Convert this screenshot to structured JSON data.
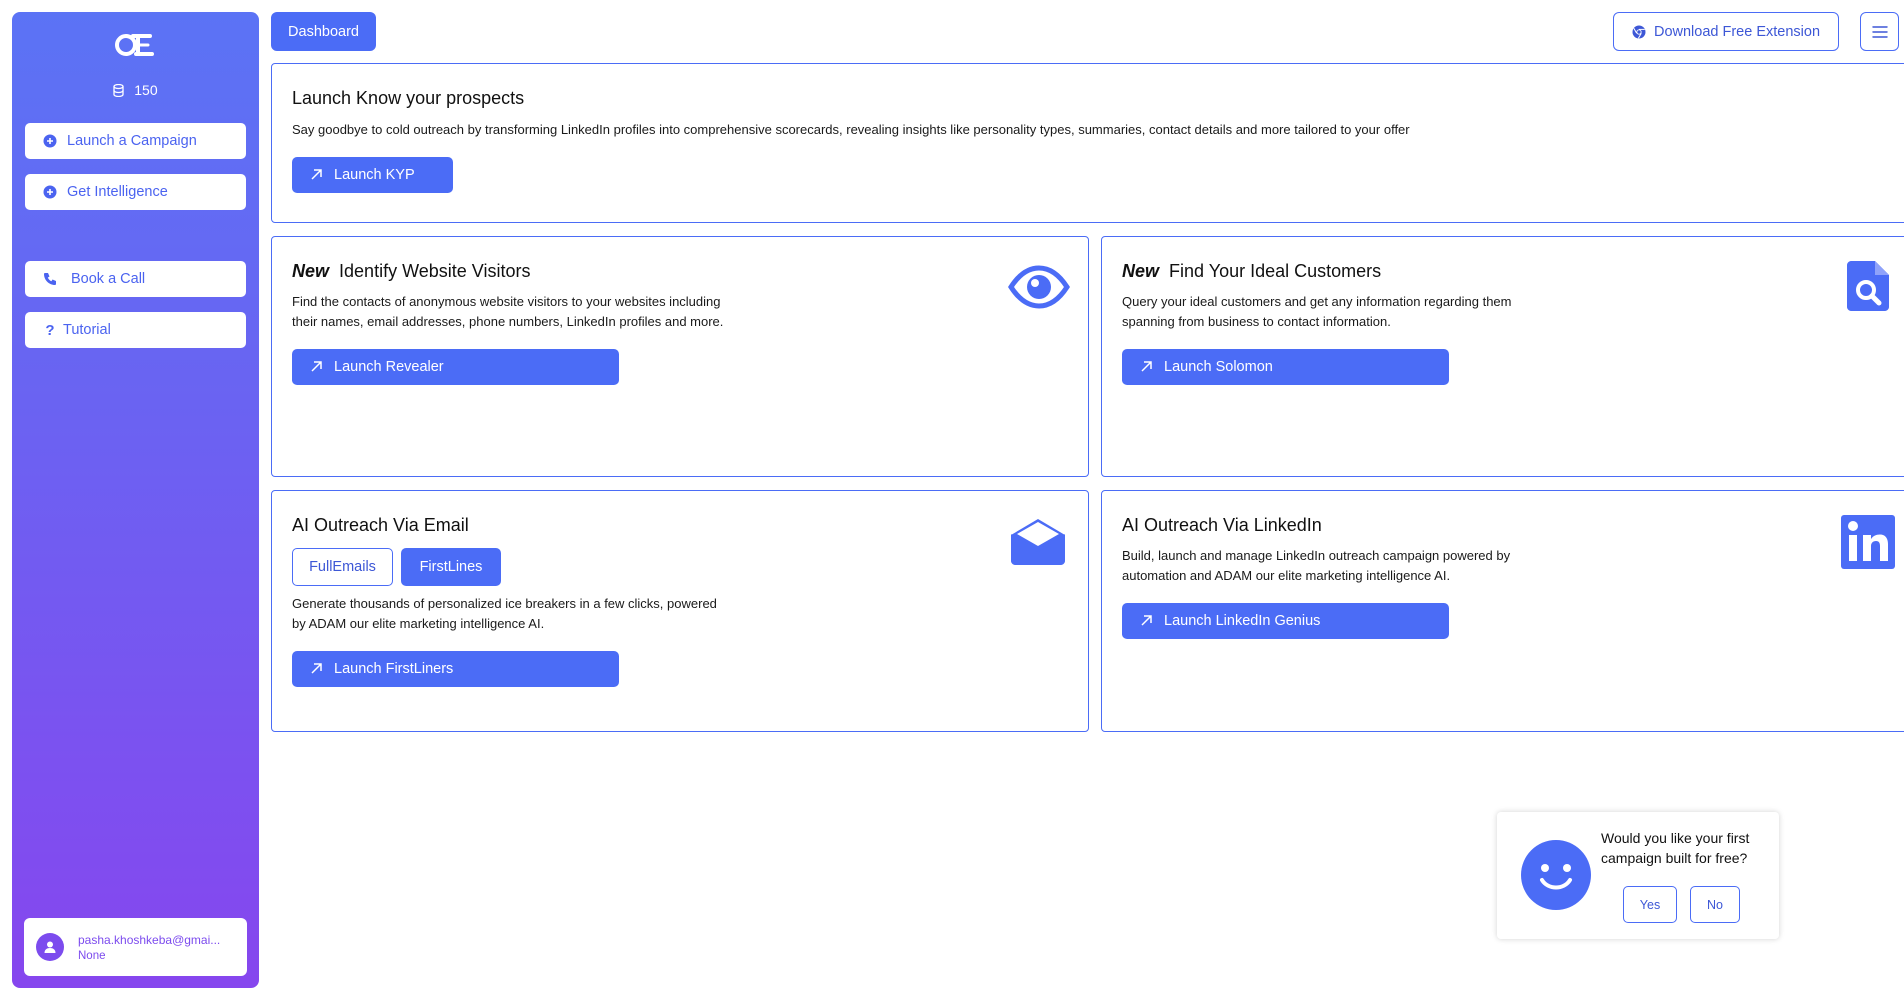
{
  "sidebar": {
    "credits": "150",
    "items": [
      {
        "label": "Launch a Campaign"
      },
      {
        "label": "Get Intelligence"
      },
      {
        "label": "Book a Call"
      },
      {
        "label": "Tutorial"
      }
    ],
    "user": {
      "email": "pasha.khoshkeba@gmai...",
      "plan": "None"
    }
  },
  "topbar": {
    "dashboard_label": "Dashboard",
    "extension_label": "Download Free Extension"
  },
  "cards": {
    "kyp": {
      "title": "Launch Know your prospects",
      "desc": "Say goodbye to cold outreach by transforming LinkedIn profiles into comprehensive scorecards, revealing insights like personality types, summaries, contact details and more tailored to your offer",
      "button": "Launch KYP"
    },
    "visitors": {
      "badge": "New",
      "title": "Identify Website Visitors",
      "desc_line1": "Find the contacts of anonymous website visitors to your websites including",
      "desc_line2": "their names, email addresses, phone numbers, LinkedIn profiles and more.",
      "button": "Launch Revealer"
    },
    "customers": {
      "badge": "New",
      "title": "Find Your Ideal Customers",
      "desc_line1": "Query your ideal customers and get any information regarding them",
      "desc_line2": "spanning from business to contact information.",
      "button": "Launch Solomon"
    },
    "email": {
      "title": "AI Outreach Via Email",
      "toggle_a": "FullEmails",
      "toggle_b": "FirstLines",
      "desc_line1": "Generate thousands of personalized ice breakers in a few clicks, powered",
      "desc_line2": "by ADAM our elite marketing intelligence AI.",
      "button": "Launch FirstLiners"
    },
    "linkedin": {
      "title": "AI Outreach Via LinkedIn",
      "desc_line1": "Build, launch and manage LinkedIn outreach campaign powered by",
      "desc_line2": "automation and ADAM our elite marketing intelligence AI.",
      "button": "Launch LinkedIn Genius"
    }
  },
  "popup": {
    "question": "Would you like your first campaign built for free?",
    "yes": "Yes",
    "no": "No"
  },
  "colors": {
    "accent": "#4b6cf6",
    "sidebar_top": "#5b73f5",
    "sidebar_bottom": "#8646ee",
    "user_text": "#7c4bee"
  }
}
